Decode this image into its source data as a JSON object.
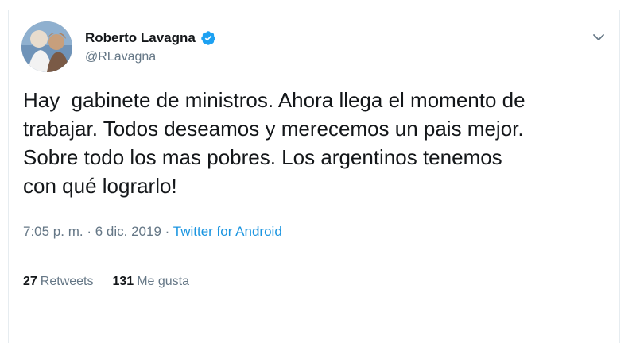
{
  "tweet": {
    "author": {
      "display_name": "Roberto Lavagna",
      "handle": "@RLavagna",
      "verified": true
    },
    "text": "Hay  gabinete de ministros. Ahora llega el momento de\ntrabajar. Todos deseamos y merecemos un pais mejor.\nSobre todo los mas pobres. Los argentinos tenemos\ncon qué lograrlo!",
    "time": "7:05 p. m.",
    "separator": "·",
    "date": "6 dic. 2019",
    "source": "Twitter for Android",
    "stats": {
      "retweets_count": "27",
      "retweets_label": "Retweets",
      "likes_count": "131",
      "likes_label": "Me gusta"
    }
  },
  "icons": {
    "verified": "verified-badge-icon",
    "menu": "chevron-down-icon"
  },
  "colors": {
    "accent": "#1b95e0",
    "verified": "#1da1f2",
    "secondary_text": "#657786",
    "divider": "#e6ecf0"
  }
}
